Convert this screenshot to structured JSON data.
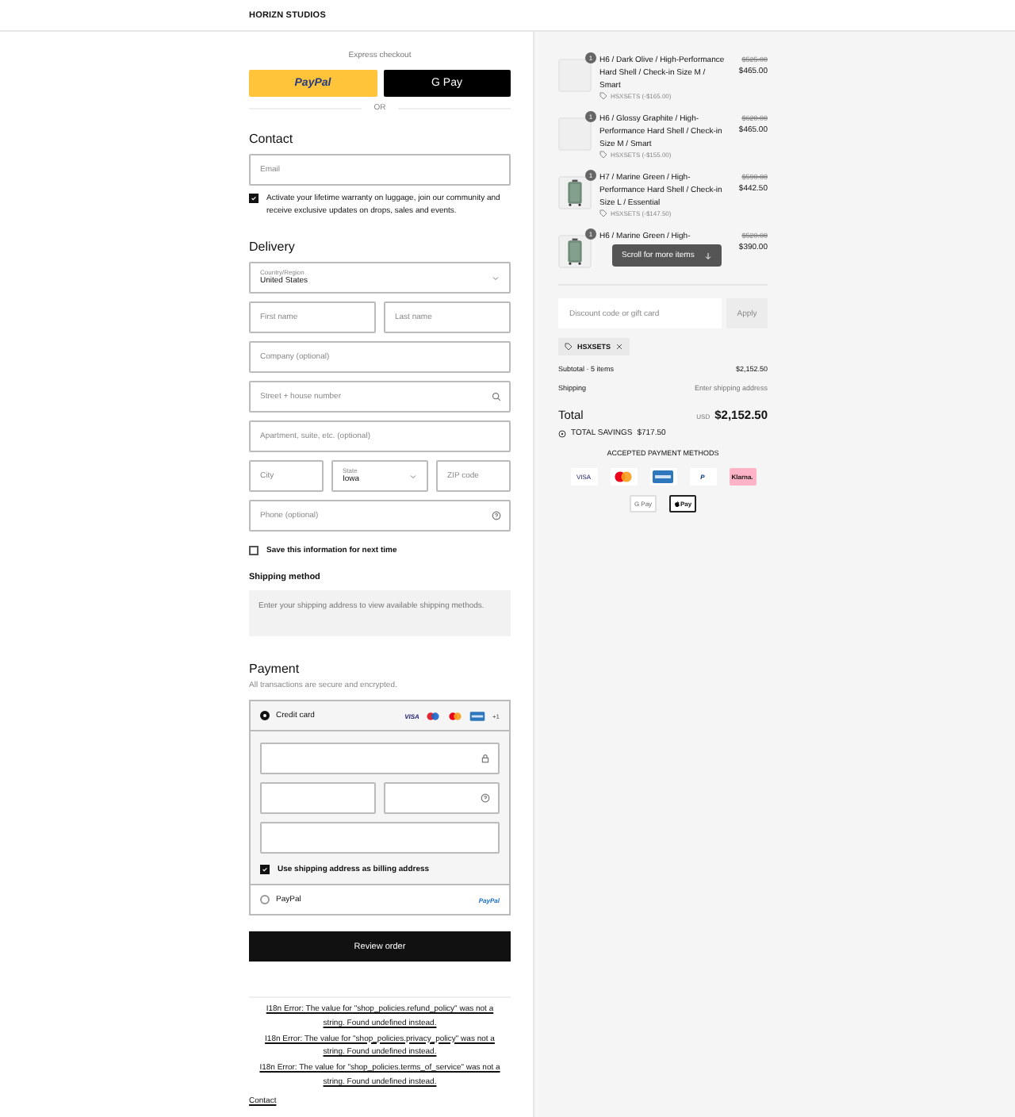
{
  "header": {
    "brand": "HORIZN STUDIOS"
  },
  "express": {
    "label": "Express checkout",
    "buttons": [
      {
        "kind": "paypal",
        "label": "PayPal"
      },
      {
        "kind": "gpay",
        "label": "G Pay"
      }
    ],
    "divider": "OR"
  },
  "contact": {
    "title": "Contact",
    "email": {
      "placeholder": "Email"
    },
    "marketing": {
      "label": "Activate your lifetime warranty on luggage, join our community and receive exclusive updates on drops, sales and events.",
      "checked": true
    }
  },
  "delivery": {
    "title": "Delivery",
    "rows": [
      [
        {
          "kind": "select",
          "label": "Country/Region",
          "value": "United States"
        }
      ],
      [
        {
          "kind": "text",
          "placeholder": "First name"
        },
        {
          "kind": "text",
          "placeholder": "Last name"
        }
      ],
      [
        {
          "kind": "text",
          "placeholder": "Company (optional)"
        }
      ],
      [
        {
          "kind": "address",
          "placeholder": "Street + house number"
        }
      ],
      [
        {
          "kind": "text",
          "placeholder": "Apartment, suite, etc. (optional)"
        }
      ],
      [
        {
          "kind": "text",
          "placeholder": "City"
        },
        {
          "kind": "select",
          "label": "State",
          "value": "Iowa"
        },
        {
          "kind": "text",
          "placeholder": "ZIP code"
        }
      ],
      [
        {
          "kind": "phone",
          "placeholder": "Phone (optional)"
        }
      ]
    ],
    "save": {
      "label": "Save this information for next time",
      "checked": false
    }
  },
  "shipping_method": {
    "title": "Shipping method",
    "note": "Enter your shipping address to view available shipping methods."
  },
  "payment": {
    "title": "Payment",
    "subtitle": "All transactions are secure and encrypted.",
    "methods": [
      {
        "kind": "card",
        "label": "Credit card",
        "selected": true,
        "cards": [
          {
            "kind": "visa",
            "label": "VISA"
          },
          {
            "kind": "maestro"
          },
          {
            "kind": "mastercard"
          },
          {
            "kind": "amex"
          }
        ],
        "more": "+1",
        "billing": {
          "label": "Use shipping address as billing address",
          "checked": true
        }
      },
      {
        "kind": "paypal",
        "label": "PayPal",
        "selected": false,
        "logo": "PayPal"
      }
    ]
  },
  "review_button": "Review order",
  "footer_links": [
    "I18n Error: The value for \"shop_policies.refund_policy\" was not a string. Found undefined instead.",
    "I18n Error: The value for \"shop_policies.privacy_policy\" was not a string. Found undefined instead.",
    "I18n Error: The value for \"shop_policies.terms_of_service\" was not a string. Found undefined instead.",
    "Contact"
  ],
  "summary": {
    "items": [
      {
        "quantity": "1",
        "title": "H6 / Dark Olive / High-Performance Hard Shell / Check-in Size M / Smart",
        "discount": "HSXSETS (-$165.00)",
        "old_price": "$525.00",
        "price": "$465.00"
      },
      {
        "quantity": "1",
        "title": "H6 / Glossy Graphite / High-Performance Hard Shell / Check-in Size M / Smart",
        "discount": "HSXSETS (-$155.00)",
        "old_price": "$620.00",
        "price": "$465.00"
      },
      {
        "kind": "picture",
        "quantity": "1",
        "title": "H7 / Marine Green / High-Performance Hard Shell / Check-in Size L / Essential",
        "discount": "HSXSETS (-$147.50)",
        "old_price": "$590.00",
        "price": "$442.50"
      },
      {
        "kind": "picture",
        "quantity": "1",
        "title": "H6 / Marine Green / High-",
        "old_price": "$520.00",
        "price": "$390.00"
      }
    ],
    "scroll_hint": "Scroll for more items",
    "discount_field": {
      "placeholder": "Discount code or gift card",
      "button": "Apply"
    },
    "applied_code": "HSXSETS",
    "subtotal": {
      "label": "Subtotal · 5 items",
      "value": "$2,152.50"
    },
    "shipping": {
      "label": "Shipping",
      "value": "Enter shipping address"
    },
    "total": {
      "label": "Total",
      "currency": "USD",
      "value": "$2,152.50"
    },
    "savings": {
      "label": "TOTAL SAVINGS",
      "value": "$717.50"
    },
    "accepted": {
      "title": "ACCEPTED PAYMENT METHODS",
      "methods": [
        {
          "kind": "visa",
          "label": "VISA"
        },
        {
          "kind": "mastercard"
        },
        {
          "kind": "amex"
        },
        {
          "kind": "paypal",
          "label": "P"
        },
        {
          "kind": "klarna",
          "label": "Klarna."
        },
        {
          "kind": "gpay",
          "label": "G Pay"
        },
        {
          "kind": "applepay",
          "label": "Pay"
        }
      ]
    }
  }
}
